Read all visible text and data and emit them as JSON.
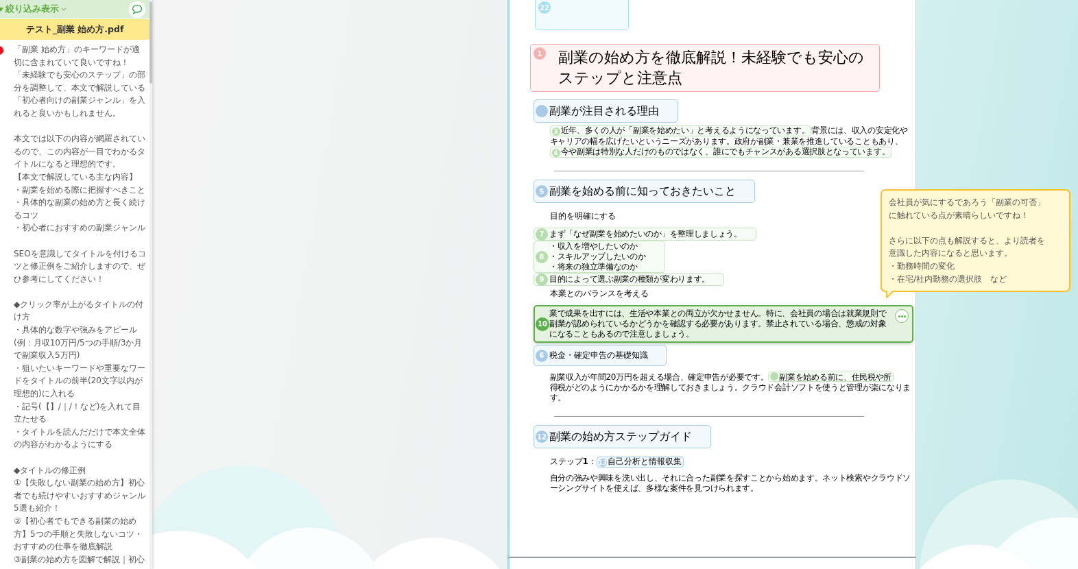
{
  "sidebar": {
    "filter_button": {
      "label": "絞り込み表示"
    },
    "file_title": "テスト_副業 始め方.pdf",
    "comment": {
      "paragraphs": [
        [
          "「副業 始め方」のキーワードが適切に含まれていて良いですね！",
          "「未経験でも安心のステップ」の部分を調整して、本文で解説している「初心者向けの副業ジャンル」を入れると良いかもしれません。"
        ],
        [
          "本文では以下の内容が網羅されているので、この内容が一目でわかるタイトルになると理想的です。",
          "【本文で解説している主な内容】",
          "・副業を始める際に把握すべきこと",
          "・具体的な副業の始め方と長く続けるコツ",
          "・初心者におすすめの副業ジャンル"
        ],
        [
          "SEOを意識してタイトルを付けるコツと修正例をご紹介しますので、ぜひ参考にしてください！"
        ],
        [
          "◆クリック率が上がるタイトルの付け方",
          "・具体的な数字や強みをアピール(例：月収10万円/5つの手順/3か月で副業収入5万円)",
          "・狙いたいキーワードや重要なワードをタイトルの前半(20文字以内が理想的)に入れる",
          "・記号(【】/｜/！など)を入れて目立たせる",
          "・タイトルを読んだだけで本文全体の内容がわかるようにする"
        ],
        [
          "◆タイトルの修正例",
          "①【失敗しない副業の始め方】初心者でも続けやすいおすすめジャンル5選も紹介！",
          "②【初心者でもできる副業の始め方】5つの手順と失敗しないコツ・おすすめの仕事を徹底解説",
          "③副業の始め方を図解で解説｜初心"
        ]
      ]
    }
  },
  "document": {
    "blocks": [
      {
        "kind": "region",
        "annotation": {
          "kind": "region",
          "number": "22",
          "selected": false
        }
      },
      {
        "kind": "title",
        "text": "副業の始め方を徹底解説！未経験でも安心のステップと注意点",
        "annotation": {
          "kind": "title",
          "number": "1",
          "selected": false
        }
      },
      {
        "kind": "heading",
        "text": "副業が注目される理由",
        "annotation": {
          "kind": "heading",
          "selected": false
        }
      },
      {
        "kind": "paragraph",
        "lines": [
          [
            {
              "text": "近年、多くの人が「副業を始めたい」と考えるようになっています。",
              "annotation": {
                "kind": "text",
                "number": "3",
                "selected": false
              }
            },
            {
              "text": "背景には、収入の安定化や"
            }
          ],
          [
            {
              "text": "キャリアの幅を広げたいというニーズがあります。政府が副業・兼業を推進していることもあり、"
            }
          ],
          [
            {
              "text": "今や副業は特別な人だけのものではなく、誰にでもチャンスがある選択肢となっています。",
              "annotation": {
                "kind": "text",
                "number": "4",
                "selected": false
              }
            }
          ]
        ]
      },
      {
        "kind": "rule"
      },
      {
        "kind": "heading",
        "text": "副業を始める前に知っておきたいこと",
        "annotation": {
          "kind": "heading",
          "number": "5",
          "selected": false
        }
      },
      {
        "kind": "subheading",
        "text": "目的を明確にする"
      },
      {
        "kind": "paragraph",
        "text": "まず「なぜ副業を始めたいのか」を整理しましょう。",
        "annotation": {
          "kind": "text",
          "number": "7",
          "selected": false
        }
      },
      {
        "kind": "list",
        "items": [
          "・収入を増やしたいのか",
          "・スキルアップしたいのか",
          "・将来の独立準備なのか"
        ],
        "annotation": {
          "kind": "text",
          "number": "8",
          "selected": false
        }
      },
      {
        "kind": "paragraph",
        "text": "目的によって選ぶ副業の種類が変わります。",
        "annotation": {
          "kind": "text",
          "number": "9",
          "selected": false
        }
      },
      {
        "kind": "subheading",
        "text": "本業とのバランスを考える"
      },
      {
        "kind": "paragraph",
        "text": "業で成果を出すには、生活や本業との両立が欠かせません。特に、会社員の場合は就業規則で副業が認められているかどうかを確認する必要があります。禁止されている場合、懲戒の対象になることもあるので注意しましょう。",
        "annotation": {
          "kind": "text",
          "number": "10",
          "selected": true
        }
      },
      {
        "kind": "subheading",
        "text": "税金・確定申告の基礎知識",
        "annotation": {
          "kind": "heading",
          "number": "6",
          "selected": false
        }
      },
      {
        "kind": "paragraph",
        "lines": [
          [
            {
              "text": "副業収入が年間20万円を超える場合、確定申告が必要です。"
            },
            {
              "text": "副業を始める前に、住民税や所",
              "annotation": {
                "kind": "text",
                "selected": false
              }
            }
          ],
          [
            {
              "text": "得税がどのようにかかるかを理解しておきましょう。クラウド会計ソフトを使うと管理が楽になりま"
            }
          ],
          [
            {
              "text": "す。"
            }
          ]
        ]
      },
      {
        "kind": "rule"
      },
      {
        "kind": "heading",
        "text": "副業の始め方ステップガイド",
        "annotation": {
          "kind": "heading",
          "number": "12",
          "selected": false
        }
      },
      {
        "kind": "subheading",
        "segments": [
          {
            "text": "ステップ**1**："
          },
          {
            "text": "自己分析と情報収集",
            "annotation": {
              "kind": "heading",
              "number": "13",
              "selected": false
            }
          }
        ]
      },
      {
        "kind": "paragraph",
        "text": "自分の強みや興味を洗い出し、それに合った副業を探すことから始めます。ネット検索やクラウドソーシングサイトを使えば、多様な案件を見つけられます。"
      }
    ]
  },
  "comment_popup": {
    "paragraphs": [
      [
        "会社員が気にするであろう「副業の可否」に触れている点が素晴らしいですね！"
      ],
      [
        "さらに以下の点も解説すると、より読者を意識した内容になると思います。",
        "・勤務時間の変化",
        "・在宅/社内勤務の選択肢　など"
      ]
    ]
  }
}
